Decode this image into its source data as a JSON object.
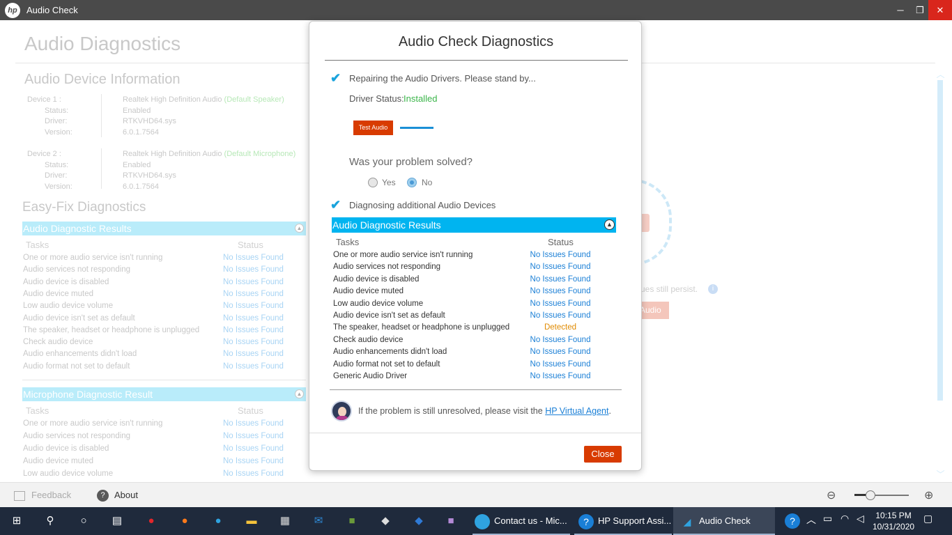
{
  "window": {
    "title": "Audio Check",
    "logo": "hp",
    "controls": [
      "─",
      "❐",
      "✕"
    ]
  },
  "background": {
    "app_title": "Audio Diagnostics",
    "device_info_title": "Audio Device Information",
    "devices": [
      {
        "header": "Device 1 :",
        "name": "Realtek High Definition Audio",
        "tag": "(Default Speaker)",
        "status_label": "Status:",
        "status": "Enabled",
        "driver_label": "Driver:",
        "driver": "RTKVHD64.sys",
        "version_label": "Version:",
        "version": "6.0.1.7564"
      },
      {
        "header": "Device 2 :",
        "name": "Realtek High Definition Audio",
        "tag": "(Default Microphone)",
        "status_label": "Status:",
        "status": "Enabled",
        "driver_label": "Driver:",
        "driver": "RTKVHD64.sys",
        "version_label": "Version:",
        "version": "6.0.1.7564"
      }
    ],
    "easy_fix_title": "Easy-Fix Diagnostics",
    "audio_results": {
      "title": "Audio Diagnostic Results",
      "tasks_header": "Tasks",
      "status_header": "Status",
      "rows": [
        {
          "task": "One or more audio service isn't running",
          "status": "No Issues Found"
        },
        {
          "task": "Audio services not responding",
          "status": "No Issues Found"
        },
        {
          "task": "Audio device is disabled",
          "status": "No Issues Found"
        },
        {
          "task": "Audio device muted",
          "status": "No Issues Found"
        },
        {
          "task": "Low audio device volume",
          "status": "No Issues Found"
        },
        {
          "task": "Audio device isn't set as default",
          "status": "No Issues Found"
        },
        {
          "task": "The speaker, headset or headphone is unplugged",
          "status": "No Issues Found"
        },
        {
          "task": "Check audio device",
          "status": "No Issues Found"
        },
        {
          "task": "Audio enhancements didn't load",
          "status": "No Issues Found"
        },
        {
          "task": "Audio format not set to default",
          "status": "No Issues Found"
        }
      ]
    },
    "mic_results": {
      "title": "Microphone Diagnostic Result",
      "tasks_header": "Tasks",
      "status_header": "Status",
      "rows": [
        {
          "task": "One or more audio service isn't running",
          "status": "No Issues Found"
        },
        {
          "task": "Audio services not responding",
          "status": "No Issues Found"
        },
        {
          "task": "Audio device is disabled",
          "status": "No Issues Found"
        },
        {
          "task": "Audio device muted",
          "status": "No Issues Found"
        },
        {
          "task": "Low audio device volume",
          "status": "No Issues Found"
        }
      ]
    },
    "right_text": "sues still persist.",
    "right_button": "Audio"
  },
  "status_bar": {
    "feedback": "Feedback",
    "about": "About",
    "zoom_level": 0.3
  },
  "dialog": {
    "title": "Audio Check Diagnostics",
    "step1": "Repairing the Audio Drivers. Please stand by...",
    "driver_status_label": "Driver Status:",
    "driver_status_value": "Installed",
    "test_audio": "Test Audio",
    "question": "Was your problem solved?",
    "options": [
      {
        "label": "Yes",
        "selected": false
      },
      {
        "label": "No",
        "selected": true
      }
    ],
    "step2": "Diagnosing additional Audio Devices",
    "results": {
      "title": "Audio Diagnostic Results",
      "tasks_header": "Tasks",
      "status_header": "Status",
      "rows": [
        {
          "task": "One or more audio service isn't running",
          "status": "No Issues Found"
        },
        {
          "task": "Audio services not responding",
          "status": "No Issues Found"
        },
        {
          "task": "Audio device is disabled",
          "status": "No Issues Found"
        },
        {
          "task": "Audio device muted",
          "status": "No Issues Found"
        },
        {
          "task": "Low audio device volume",
          "status": "No Issues Found"
        },
        {
          "task": "Audio device isn't set as default",
          "status": "No Issues Found"
        },
        {
          "task": "The speaker, headset or headphone is unplugged",
          "status": "Detected"
        },
        {
          "task": "Check audio device",
          "status": "No Issues Found"
        },
        {
          "task": "Audio enhancements didn't load",
          "status": "No Issues Found"
        },
        {
          "task": "Audio format not set to default",
          "status": "No Issues Found"
        },
        {
          "task": "Generic Audio Driver",
          "status": "No Issues Found"
        }
      ]
    },
    "unresolved_text": "If the problem is still unresolved, please visit the ",
    "agent_link": "HP Virtual Agent",
    "agent_suffix": ".",
    "close": "Close"
  },
  "taskbar": {
    "apps": [
      {
        "label": "Contact us - Mic...",
        "icon": "edge-icon"
      },
      {
        "label": "HP Support Assi...",
        "icon": "help-icon"
      },
      {
        "label": "Audio Check",
        "icon": "audio-check-icon",
        "active": true
      }
    ],
    "time": "10:15 PM",
    "date": "10/31/2020"
  },
  "colors": {
    "accent": "#00b4f0",
    "danger_button": "#d83b01",
    "ok_status": "#1a7fd6",
    "warn_status": "#e08a00",
    "installed": "#3bb54a"
  }
}
